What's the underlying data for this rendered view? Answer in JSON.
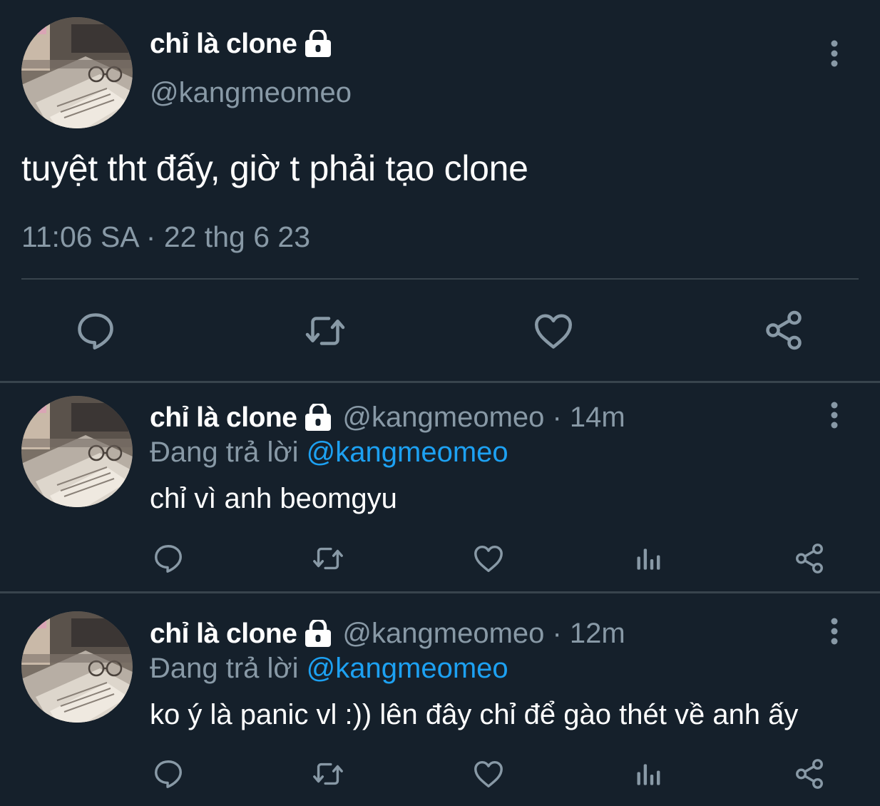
{
  "main_tweet": {
    "display_name": "chỉ là clone",
    "handle": "@kangmeomeo",
    "text": "tuyệt tht đấy, giờ t phải tạo clone",
    "timestamp": "11:06 SA · 22 thg 6 23",
    "protected": true,
    "actions": [
      "reply-icon",
      "retweet-icon",
      "like-icon",
      "share-icon"
    ]
  },
  "replies": [
    {
      "display_name": "chỉ là clone",
      "meta": "@kangmeomeo · 14m",
      "replying_prefix": "Đang trả lời",
      "replying_to": "@kangmeomeo",
      "text": "chỉ vì anh beomgyu",
      "actions": [
        "reply-icon",
        "retweet-icon",
        "like-icon",
        "analytics-icon",
        "share-icon"
      ]
    },
    {
      "display_name": "chỉ là clone",
      "meta": "@kangmeomeo · 12m",
      "replying_prefix": "Đang trả lời",
      "replying_to": "@kangmeomeo",
      "text": "ko ý là panic vl :)) lên đây chỉ để gào thét về anh ấy",
      "actions": [
        "reply-icon",
        "retweet-icon",
        "like-icon",
        "analytics-icon",
        "share-icon"
      ]
    }
  ],
  "colors": {
    "background": "#15202b",
    "secondary_text": "#8899a6",
    "mention": "#1da1f2",
    "divider": "#38444d"
  }
}
